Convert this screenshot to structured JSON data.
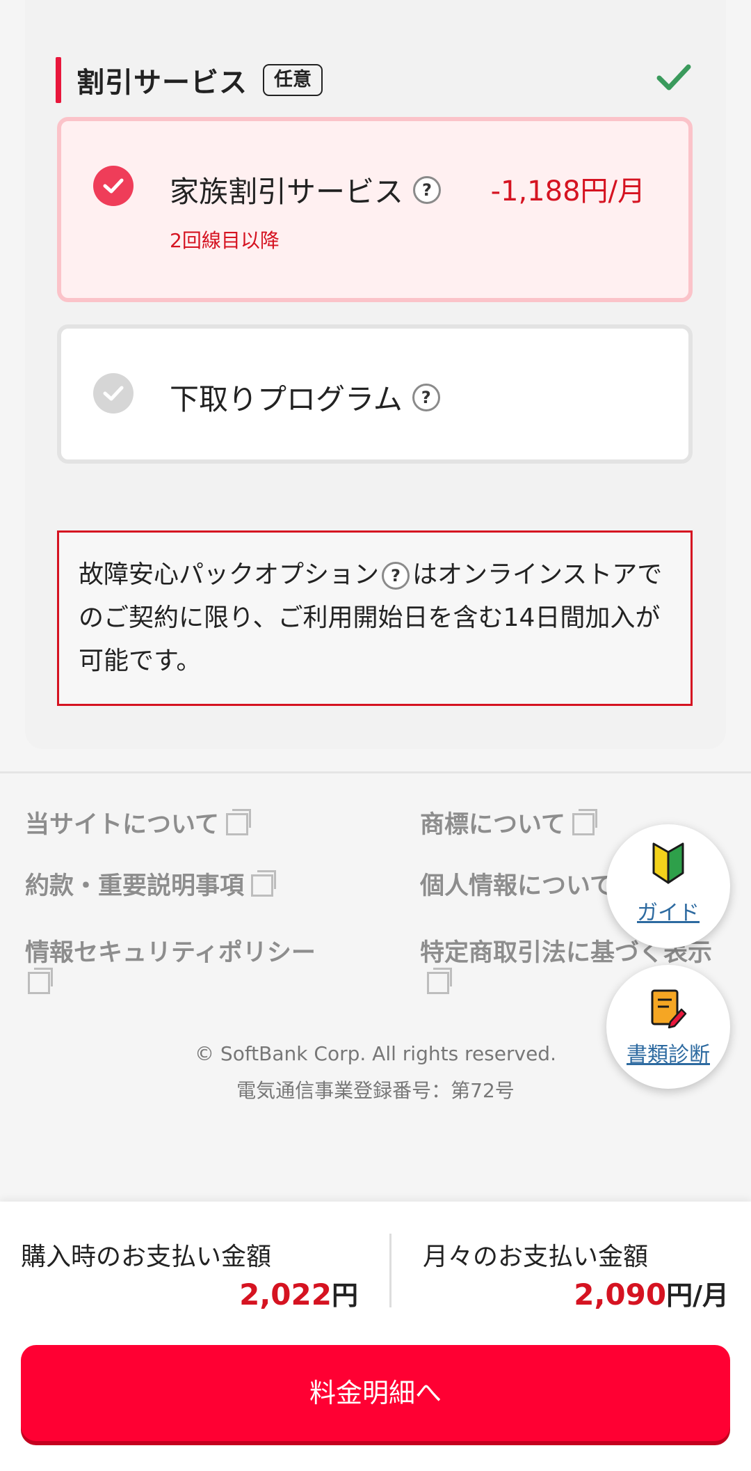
{
  "section": {
    "title": "割引サービス",
    "badge": "任意"
  },
  "options": [
    {
      "label": "家族割引サービス",
      "price": "-1,188円/月",
      "sub": "2回線目以降",
      "selected": true
    },
    {
      "label": "下取りプログラム",
      "selected": false
    }
  ],
  "notice": {
    "text_before": "故障安心パックオプション",
    "text_after": "はオンラインストアでのご契約に限り、ご利用開始日を含む14日間加入が可能です。"
  },
  "footer": {
    "links": [
      "当サイトについて",
      "商標について",
      "約款・重要説明事項",
      "個人情報について",
      "情報セキュリティポリシー",
      "特定商取引法に基づく表示"
    ],
    "copyright": "© SoftBank Corp. All rights reserved.",
    "registration": "電気通信事業登録番号：第72号"
  },
  "fabs": {
    "guide": "ガイド",
    "doc_check": "書類診断"
  },
  "payment": {
    "purchase_label": "購入時のお支払い金額",
    "purchase_amount": "2,022",
    "purchase_unit": "円",
    "monthly_label": "月々のお支払い金額",
    "monthly_amount": "2,090",
    "monthly_unit": "円/月"
  },
  "cta": {
    "label": "料金明細へ"
  },
  "colors": {
    "accent": "#ff0033",
    "price_red": "#d51321",
    "check_green": "#3a9a5c"
  }
}
